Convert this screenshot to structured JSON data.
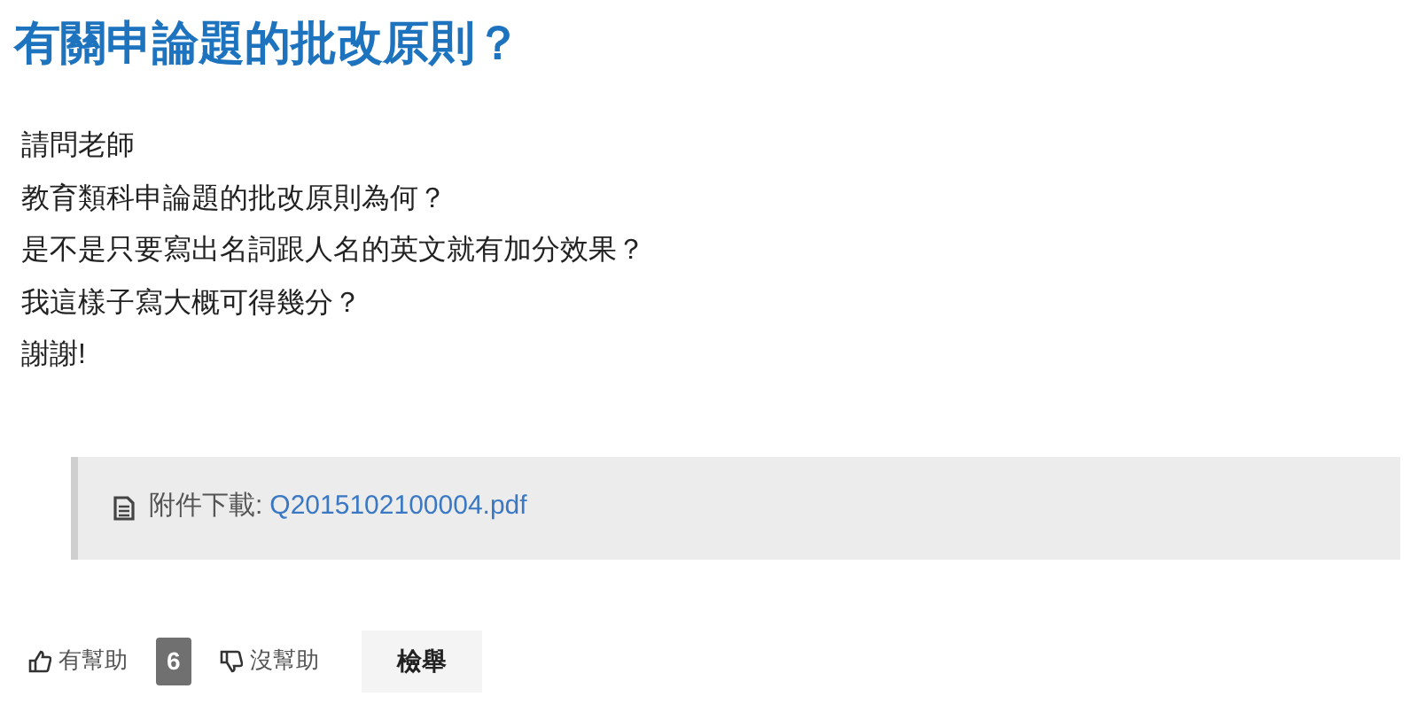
{
  "title": "有關申論題的批改原則？",
  "body_lines": [
    "請問老師",
    "教育類科申論題的批改原則為何？",
    "是不是只要寫出名詞跟人名的英文就有加分效果？",
    "我這樣子寫大概可得幾分？",
    "謝謝!"
  ],
  "attachment": {
    "label": "附件下載:",
    "file": "Q2015102100004.pdf"
  },
  "actions": {
    "helpful": "有幫助",
    "count": "6",
    "not_helpful": "沒幫助",
    "report": "檢舉"
  }
}
